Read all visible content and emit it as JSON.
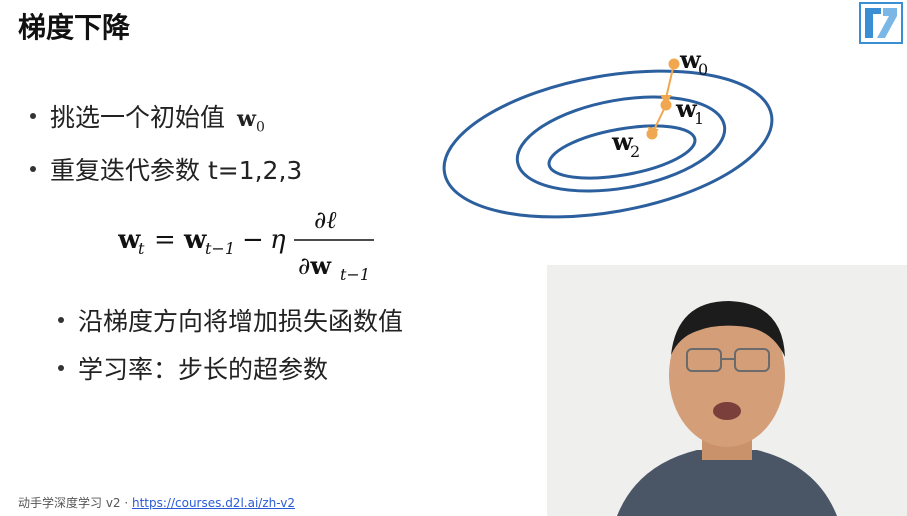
{
  "slide": {
    "title": "梯度下降",
    "bullets": [
      {
        "text": "挑选一个初始值",
        "math": "w",
        "math_sub": "0"
      },
      {
        "text": "重复迭代参数 t=1,2,3"
      }
    ],
    "sub_bullets": [
      "沿梯度方向将增加损失函数值",
      "学习率：步长的超参数"
    ],
    "formula": {
      "lhs": "w",
      "lhs_sub": "t",
      "rhs_w": "w",
      "rhs_w_sub": "t−1",
      "eta": "η",
      "numerator": "∂ℓ",
      "denominator": "∂w",
      "denominator_sub": "t−1"
    },
    "diagram": {
      "labels": [
        {
          "name": "w",
          "sub": "0"
        },
        {
          "name": "w",
          "sub": "1"
        },
        {
          "name": "w",
          "sub": "2"
        }
      ],
      "ellipse_color": "#2b5f9e",
      "point_color": "#f0a750"
    },
    "footer": {
      "text": "动手学深度学习 v2 · ",
      "link": "https://courses.d2l.ai/zh-v2",
      "link_color": "#2a5bd7"
    },
    "logo_icon": "d2l-logo-icon",
    "webcam_icon": "presenter-video"
  }
}
